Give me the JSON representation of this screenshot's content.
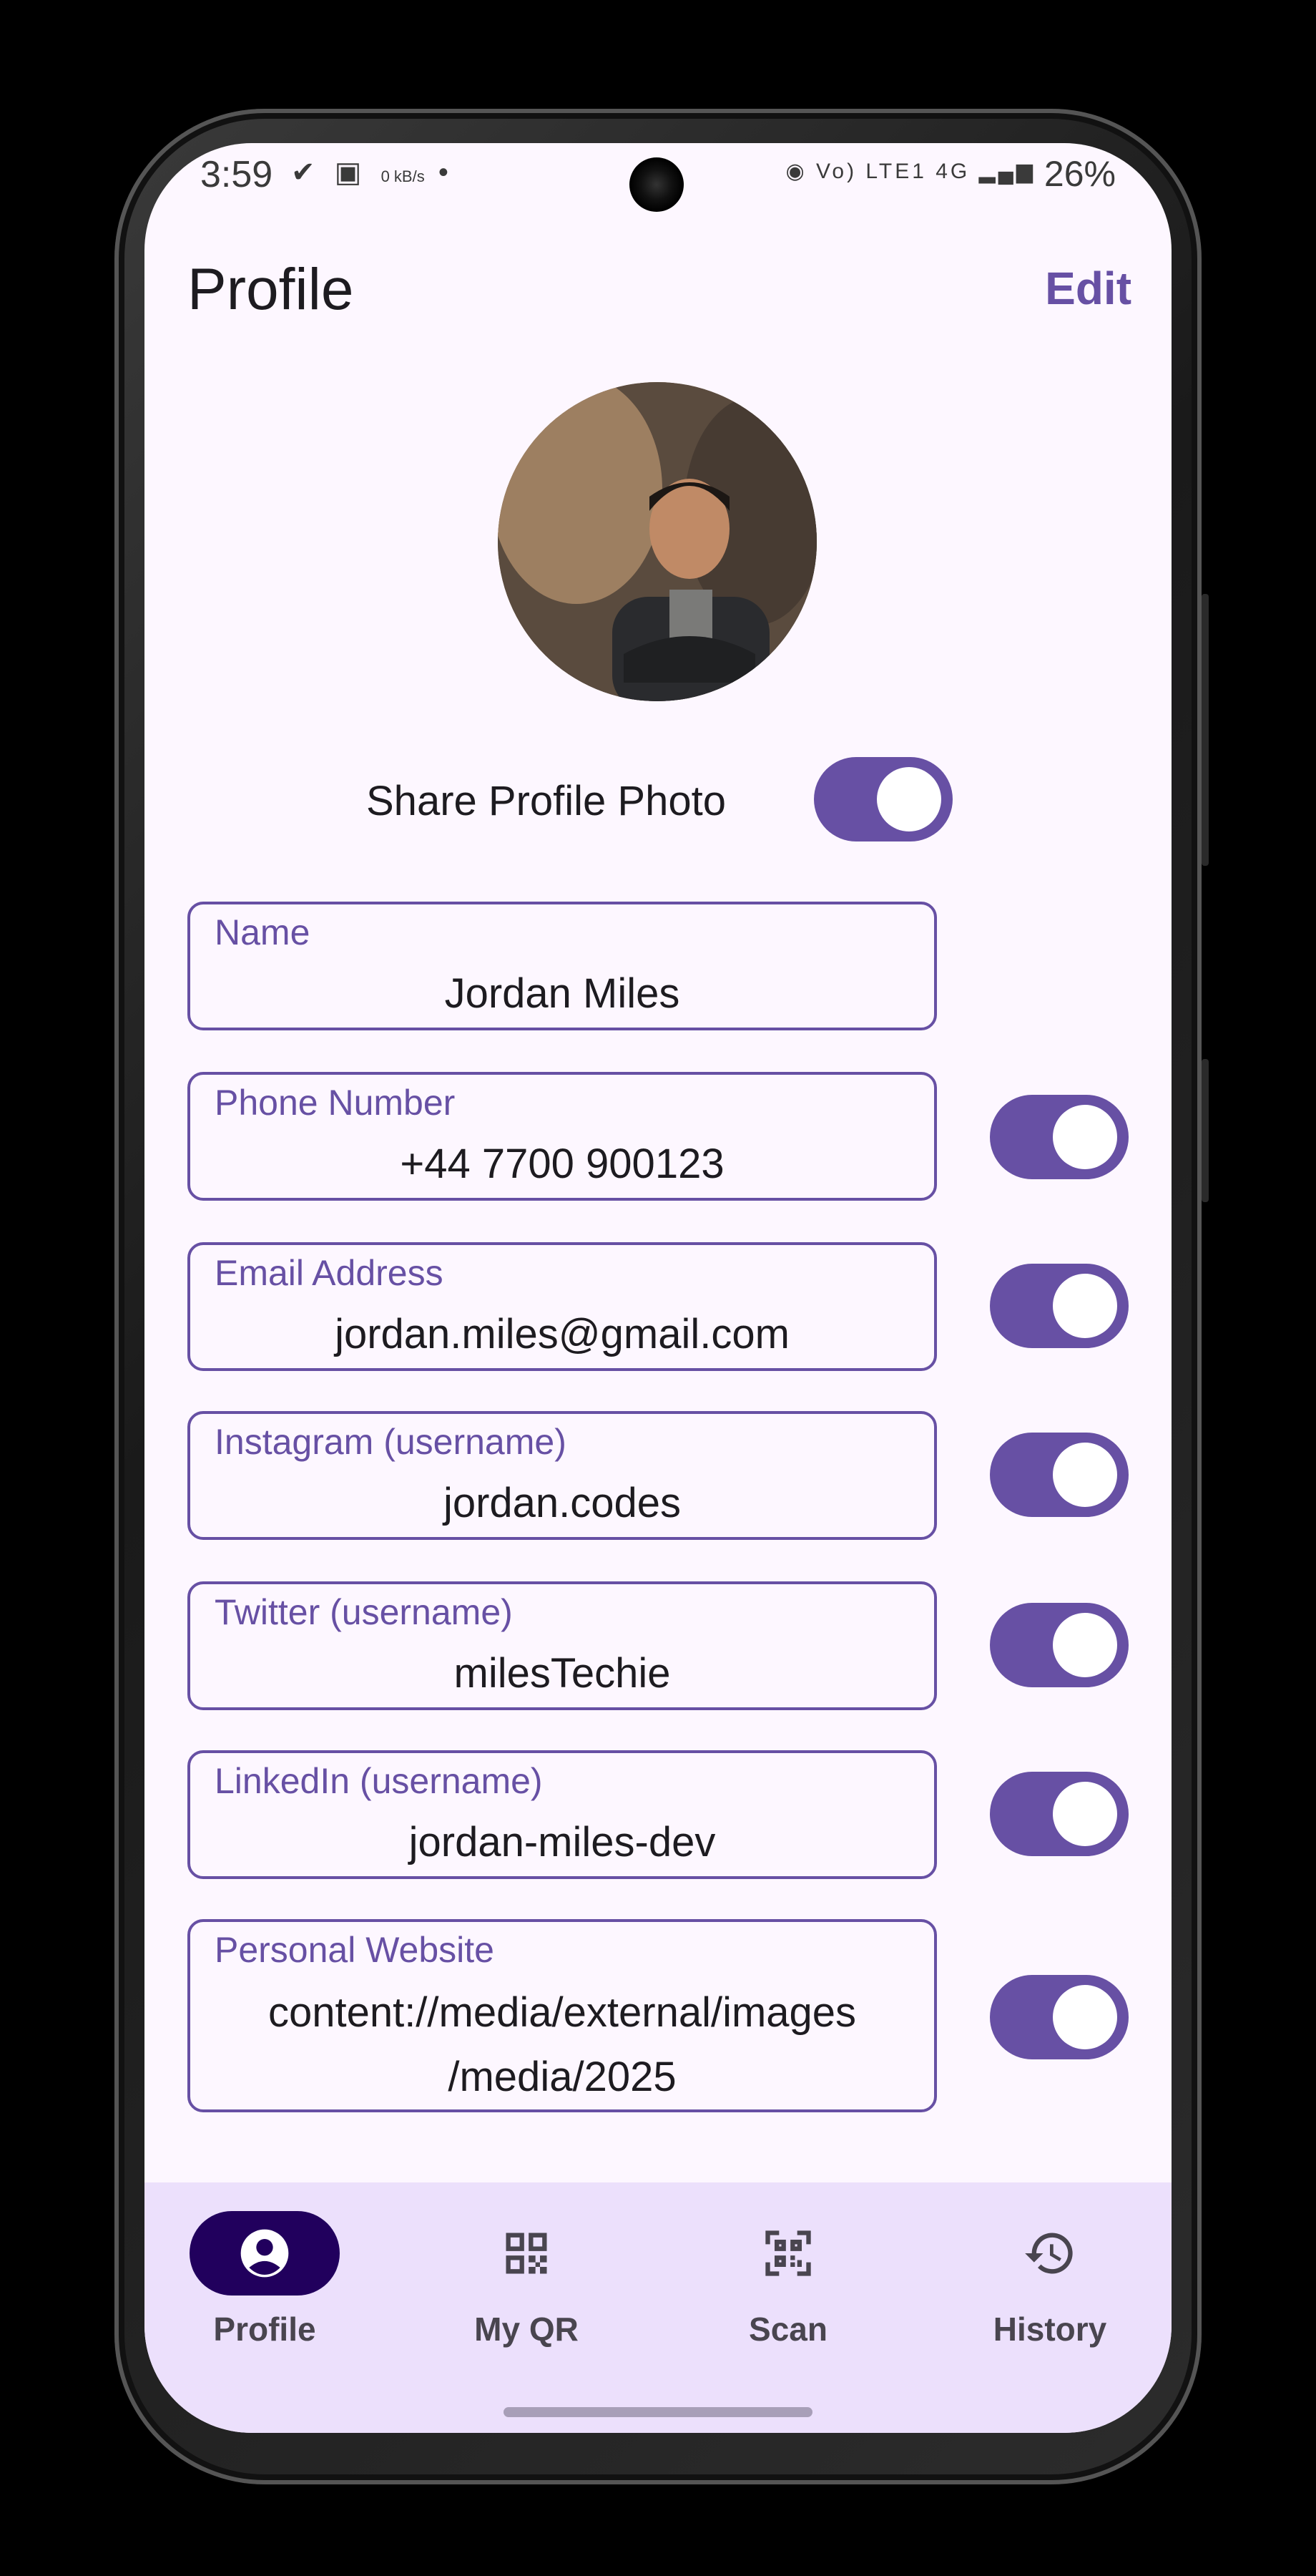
{
  "status_bar": {
    "time": "3:59",
    "left_icons": [
      "check-icon",
      "image-icon",
      "speed-icon",
      "dot-icon"
    ],
    "speed_text": "0 kB/s",
    "network": "Vo) LTE1 4G",
    "battery": "26%"
  },
  "header": {
    "title": "Profile",
    "edit_label": "Edit"
  },
  "profile": {
    "share_photo_label": "Share Profile Photo",
    "share_photo_on": true
  },
  "fields": [
    {
      "label": "Name",
      "value": "Jordan Miles",
      "has_toggle": false
    },
    {
      "label": "Phone Number",
      "value": "+44 7700 900123",
      "has_toggle": true,
      "on": true
    },
    {
      "label": "Email Address",
      "value": "jordan.miles@gmail.com",
      "has_toggle": true,
      "on": true
    },
    {
      "label": "Instagram (username)",
      "value": "jordan.codes",
      "has_toggle": true,
      "on": true
    },
    {
      "label": "Twitter (username)",
      "value": "milesTechie",
      "has_toggle": true,
      "on": true
    },
    {
      "label": "LinkedIn (username)",
      "value": "jordan-miles-dev",
      "has_toggle": true,
      "on": true
    },
    {
      "label": "Personal Website",
      "value_line1": "content://media/external/images",
      "value_line2": "/media/2025",
      "has_toggle": true,
      "on": true
    }
  ],
  "bottom_nav": {
    "items": [
      {
        "label": "Profile",
        "icon": "account-circle-icon",
        "active": true
      },
      {
        "label": "My QR",
        "icon": "qr-code-icon",
        "active": false
      },
      {
        "label": "Scan",
        "icon": "qr-scan-icon",
        "active": false
      },
      {
        "label": "History",
        "icon": "history-icon",
        "active": false
      }
    ]
  },
  "colors": {
    "primary": "#6750a4",
    "surface": "#fdf7ff",
    "nav_background": "#ece0fc",
    "nav_active": "#21005d"
  }
}
